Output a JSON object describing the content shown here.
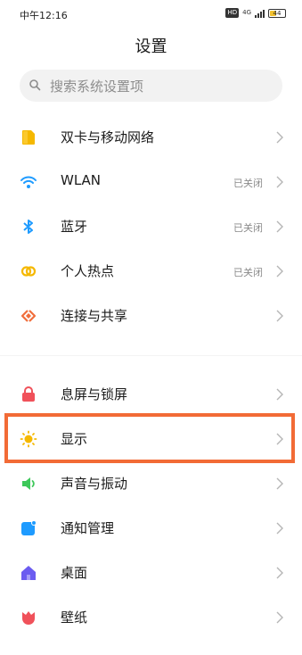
{
  "status_bar": {
    "time": "中午12:16",
    "hd": "HD",
    "network": "4G",
    "battery": "44",
    "battery_level": 0.44
  },
  "header": {
    "title": "设置"
  },
  "search": {
    "placeholder": "搜索系统设置项"
  },
  "groups": [
    {
      "items": [
        {
          "label": "双卡与移动网络",
          "value": "",
          "icon": "sim-card-icon",
          "color": "#f5b800"
        },
        {
          "label": "WLAN",
          "value": "已关闭",
          "icon": "wifi-icon",
          "color": "#1e9bff"
        },
        {
          "label": "蓝牙",
          "value": "已关闭",
          "icon": "bluetooth-icon",
          "color": "#1e9bff"
        },
        {
          "label": "个人热点",
          "value": "已关闭",
          "icon": "hotspot-icon",
          "color": "#f5b800"
        },
        {
          "label": "连接与共享",
          "value": "",
          "icon": "connection-share-icon",
          "color": "#f06e3c"
        }
      ]
    },
    {
      "items": [
        {
          "label": "息屏与锁屏",
          "value": "",
          "icon": "lock-icon",
          "color": "#f0515a"
        },
        {
          "label": "显示",
          "value": "",
          "icon": "sun-icon",
          "color": "#f5b800",
          "highlighted": true
        },
        {
          "label": "声音与振动",
          "value": "",
          "icon": "speaker-icon",
          "color": "#3ec85a"
        },
        {
          "label": "通知管理",
          "value": "",
          "icon": "notification-icon",
          "color": "#1e9bff"
        },
        {
          "label": "桌面",
          "value": "",
          "icon": "home-icon",
          "color": "#6b5cf0"
        },
        {
          "label": "壁纸",
          "value": "",
          "icon": "wallpaper-icon",
          "color": "#f0515a"
        }
      ]
    }
  ],
  "highlight_color": "#f26b36"
}
